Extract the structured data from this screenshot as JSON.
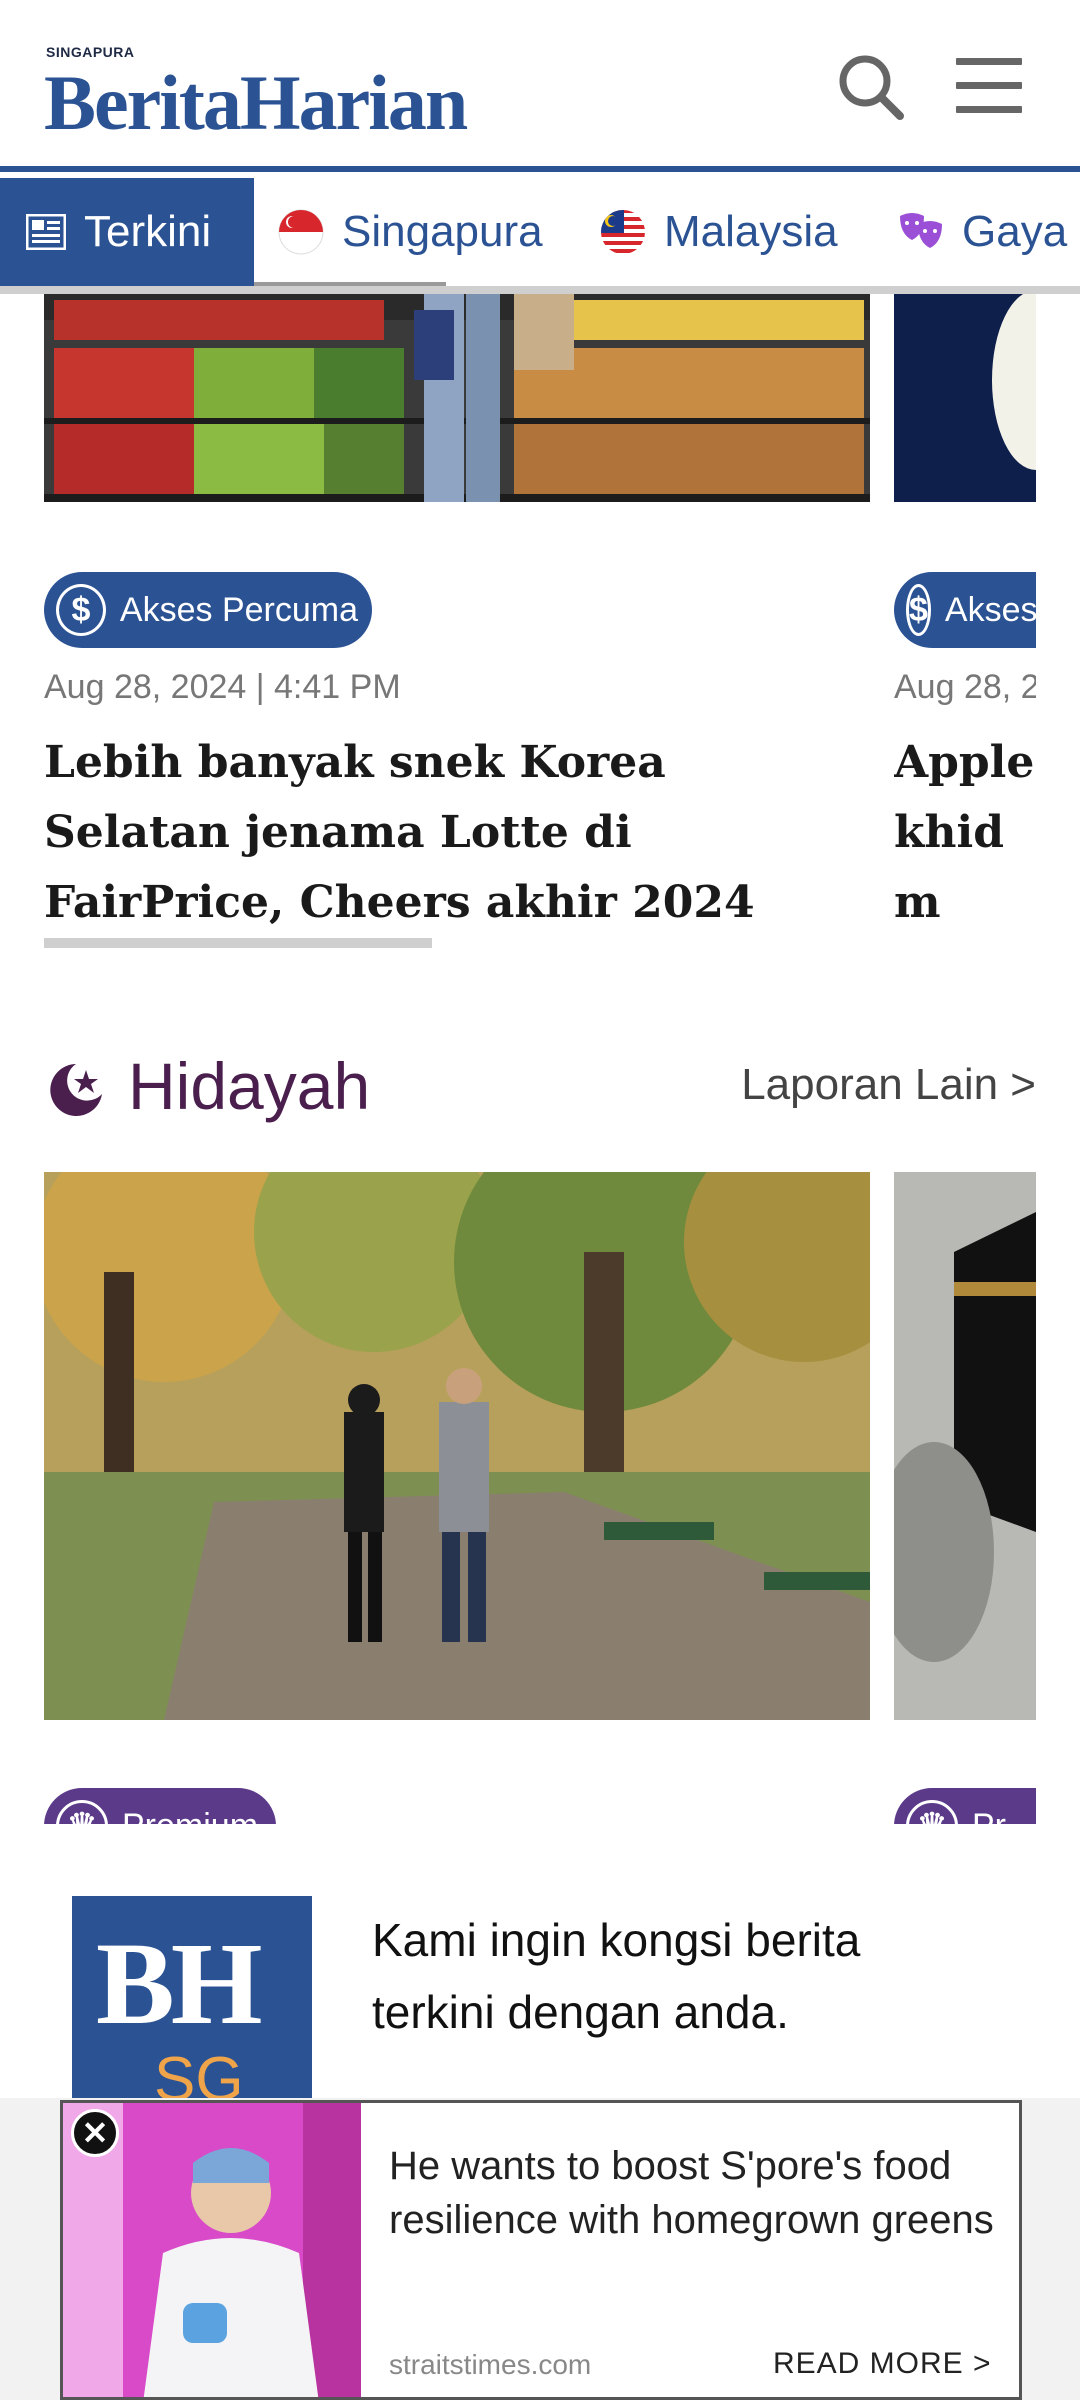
{
  "header": {
    "brand_small": "SINGAPURA",
    "brand": "BeritaHarian"
  },
  "tabs": [
    {
      "label": "Terkini",
      "icon": "newspaper-icon",
      "active": true
    },
    {
      "label": "Singapura",
      "icon": "singapore-flag-icon"
    },
    {
      "label": "Malaysia",
      "icon": "malaysia-flag-icon"
    },
    {
      "label": "Gaya",
      "icon": "theatre-masks-icon"
    }
  ],
  "articles": [
    {
      "badge": "Akses Percuma",
      "date": "Aug 28, 2024 | 4:41 PM",
      "headline": "Lebih banyak snek Korea Selatan jenama Lotte di FairPrice, Cheers akhir 2024"
    },
    {
      "badge": "Akses Percuma",
      "date": "Aug 28, 2",
      "headline": "Apple khidm"
    }
  ],
  "section": {
    "title": "Hidayah",
    "more": "Laporan Lain >",
    "icon": "crescent-star-icon",
    "color": "#4a1f4e"
  },
  "section_cards": [
    {
      "badge": "Premium"
    },
    {
      "badge": "Pr"
    }
  ],
  "promo": {
    "logo_bh": "BH",
    "logo_sg": "SG",
    "text": "Kami ingin kongsi berita terkini dengan anda."
  },
  "ad": {
    "headline": "He wants to boost S'pore's food resilience with homegrown greens",
    "source": "straitstimes.com",
    "cta": "READ MORE >"
  },
  "colors": {
    "brand_blue": "#2b5394",
    "section_purple": "#4a1f4e",
    "tab_red": "#d7262c"
  }
}
